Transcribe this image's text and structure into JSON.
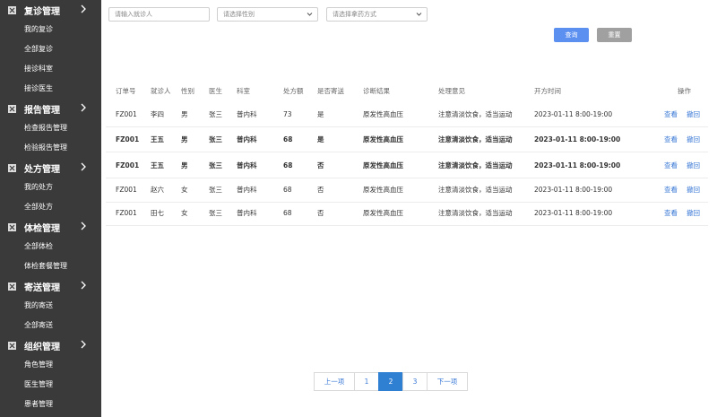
{
  "sidebar": {
    "groups": [
      {
        "title": "复诊管理",
        "items": [
          "我的复诊",
          "全部复诊",
          "接诊科室",
          "接诊医生"
        ]
      },
      {
        "title": "报告管理",
        "items": [
          "检查报告管理",
          "检验报告管理"
        ]
      },
      {
        "title": "处方管理",
        "items": [
          "我的处方",
          "全部处方"
        ]
      },
      {
        "title": "体检管理",
        "items": [
          "全部体检",
          "体检套餐管理"
        ]
      },
      {
        "title": "寄送管理",
        "items": [
          "我的寄送",
          "全部寄送"
        ]
      },
      {
        "title": "组织管理",
        "items": [
          "角色管理",
          "医生管理",
          "患者管理"
        ]
      }
    ]
  },
  "filters": {
    "patient_placeholder": "请输入就诊人",
    "gender_placeholder": "请选择性别",
    "pickup_placeholder": "请选择拿药方式"
  },
  "buttons": {
    "query": "查询",
    "reset": "重置"
  },
  "table": {
    "headers": [
      "订单号",
      "就诊人",
      "性别",
      "医生",
      "科室",
      "处方额",
      "是否寄送",
      "诊断结果",
      "处理意见",
      "开方时间",
      "操作"
    ],
    "rows": [
      {
        "order": "FZ001",
        "patient": "李四",
        "gender": "男",
        "doctor": "张三",
        "dept": "普内科",
        "amount": "73",
        "ship": "是",
        "diag": "原发性高血压",
        "advice": "注意清淡饮食，适当运动",
        "time": "2023-01-11 8:00-19:00",
        "view": "查看",
        "revoke": "撤回"
      },
      {
        "order": "FZ001",
        "patient": "王五",
        "gender": "男",
        "doctor": "张三",
        "dept": "普内科",
        "amount": "68",
        "ship": "是",
        "diag": "原发性高血压",
        "advice": "注意清淡饮食，适当运动",
        "time": "2023-01-11 8:00-19:00",
        "view": "查看",
        "revoke": "撤回"
      },
      {
        "order": "FZ001",
        "patient": "王五",
        "gender": "男",
        "doctor": "张三",
        "dept": "普内科",
        "amount": "68",
        "ship": "否",
        "diag": "原发性高血压",
        "advice": "注意清淡饮食，适当运动",
        "time": "2023-01-11 8:00-19:00",
        "view": "查看",
        "revoke": "撤回"
      },
      {
        "order": "FZ001",
        "patient": "赵六",
        "gender": "女",
        "doctor": "张三",
        "dept": "普内科",
        "amount": "68",
        "ship": "否",
        "diag": "原发性高血压",
        "advice": "注意清淡饮食，适当运动",
        "time": "2023-01-11 8:00-19:00",
        "view": "查看",
        "revoke": "撤回"
      },
      {
        "order": "FZ001",
        "patient": "田七",
        "gender": "女",
        "doctor": "张三",
        "dept": "普内科",
        "amount": "68",
        "ship": "否",
        "diag": "原发性高血压",
        "advice": "注意清淡饮食，适当运动",
        "time": "2023-01-11 8:00-19:00",
        "view": "查看",
        "revoke": "撤回"
      }
    ]
  },
  "pagination": {
    "prev": "上一项",
    "pages": [
      "1",
      "2",
      "3"
    ],
    "current": "2",
    "next": "下一项"
  },
  "colors": {
    "sidebar_bg": "#3a3a3a",
    "primary": "#5b8ff0",
    "reset": "#a0a0a0",
    "link": "#3a78d6",
    "page_active": "#2f7fd3"
  }
}
